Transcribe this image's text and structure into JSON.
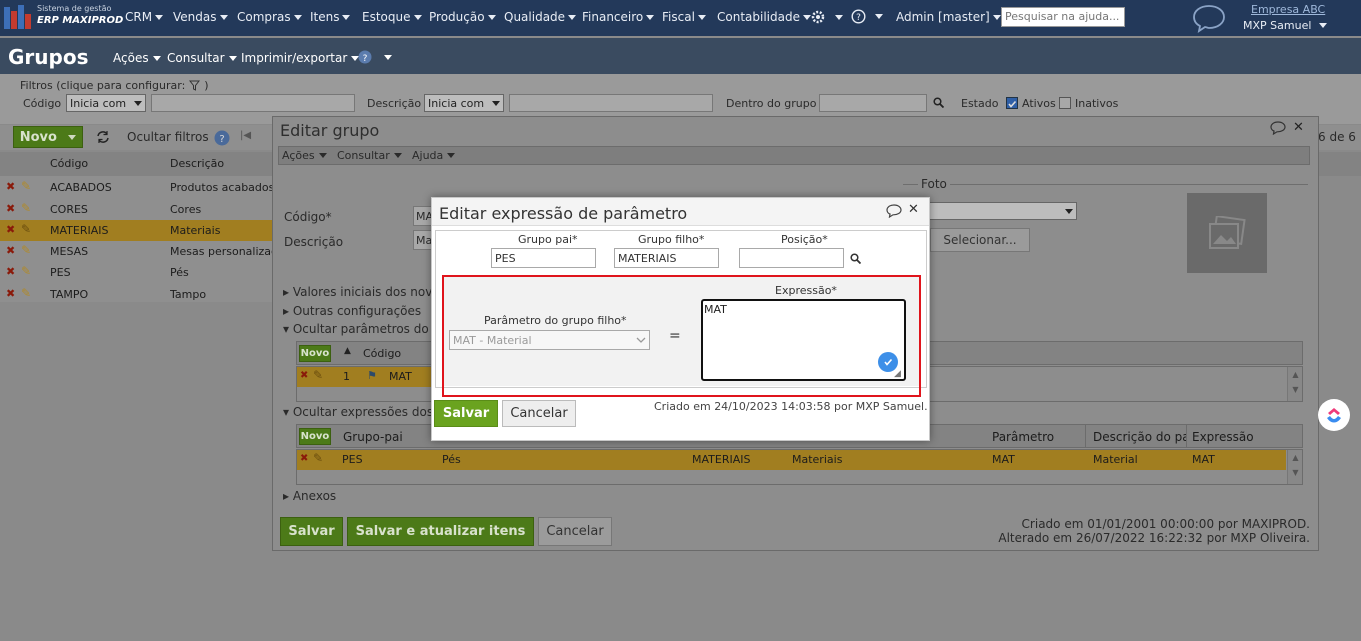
{
  "topnav": {
    "logo_line1": "Sistema de gestão",
    "logo_line2": "ERP MAXIPROD",
    "menus": [
      "CRM",
      "Vendas",
      "Compras",
      "Itens",
      "Estoque",
      "Produção",
      "Qualidade",
      "Financeiro",
      "Fiscal",
      "Contabilidade"
    ],
    "admin": "Admin [master]",
    "help_placeholder": "Pesquisar na ajuda...",
    "company": "Empresa ABC",
    "user": "MXP Samuel"
  },
  "page": {
    "title": "Grupos",
    "menus": [
      "Ações",
      "Consultar",
      "Imprimir/exportar"
    ]
  },
  "filters": {
    "legend": "Filtros (clique para configurar:",
    "codigo_label": "Código",
    "codigo_mode": "Inicia com",
    "descricao_label": "Descrição",
    "descricao_mode": "Inicia com",
    "dentro_label": "Dentro do grupo",
    "estado_label": "Estado",
    "ativos": "Ativos",
    "inativos": "Inativos"
  },
  "list": {
    "novo": "Novo",
    "ocultar": "Ocultar filtros",
    "paging": "6 de 6",
    "headers": [
      "Código",
      "Descrição"
    ],
    "rows": [
      {
        "codigo": "ACABADOS",
        "descricao": "Produtos acabados"
      },
      {
        "codigo": "CORES",
        "descricao": "Cores"
      },
      {
        "codigo": "MATERIAIS",
        "descricao": "Materiais"
      },
      {
        "codigo": "MESAS",
        "descricao": "Mesas personalizadas"
      },
      {
        "codigo": "PES",
        "descricao": "Pés"
      },
      {
        "codigo": "TAMPO",
        "descricao": "Tampo"
      }
    ]
  },
  "editar_grupo": {
    "title": "Editar grupo",
    "menus": [
      "Ações",
      "Consultar",
      "Ajuda"
    ],
    "codigo_label": "Código*",
    "codigo_value": "MATERIAIS",
    "descricao_label": "Descrição",
    "descricao_value": "Materiais",
    "foto_label": "Foto",
    "selecionar": "Selecionar...",
    "sections": [
      "Valores iniciais dos novos itens",
      "Outras configurações",
      "Ocultar parâmetros do grupo",
      "Ocultar expressões dos parâmetros",
      "Anexos"
    ],
    "param_grid": {
      "novo": "Novo",
      "headers": [
        "Código"
      ],
      "row": {
        "ordem": "1",
        "codigo": "MAT"
      }
    },
    "expr_grid": {
      "novo": "Novo",
      "headers": [
        "Grupo-pai",
        "Parâmetro",
        "Descrição do parâmetro",
        "Expressão"
      ],
      "row": {
        "grupo_pai": "PES",
        "descricao_pai": "Pés",
        "grupo_filho": "MATERIAIS",
        "descricao_filho": "Materiais",
        "parametro": "MAT",
        "descricao_param": "Material",
        "expressao": "MAT"
      }
    },
    "buttons": {
      "salvar": "Salvar",
      "salvar_atualizar": "Salvar e atualizar itens",
      "cancelar": "Cancelar"
    },
    "audit_created": "Criado em 01/01/2001 00:00:00 por MAXIPROD.",
    "audit_updated": "Alterado em 26/07/2022 16:22:32 por MXP Oliveira."
  },
  "editar_expressao": {
    "title": "Editar expressão de parâmetro",
    "grupo_pai_label": "Grupo pai*",
    "grupo_pai_value": "PES",
    "grupo_filho_label": "Grupo filho*",
    "grupo_filho_value": "MATERIAIS",
    "posicao_label": "Posição*",
    "posicao_value": "",
    "param_label": "Parâmetro do grupo filho*",
    "param_value": "MAT - Material",
    "equals": "=",
    "expressao_label": "Expressão*",
    "expressao_value": "MAT",
    "salvar": "Salvar",
    "cancelar": "Cancelar",
    "audit": "Criado em 24/10/2023 14:03:58 por MXP Samuel.",
    "highlight_color": "#e0141c"
  }
}
